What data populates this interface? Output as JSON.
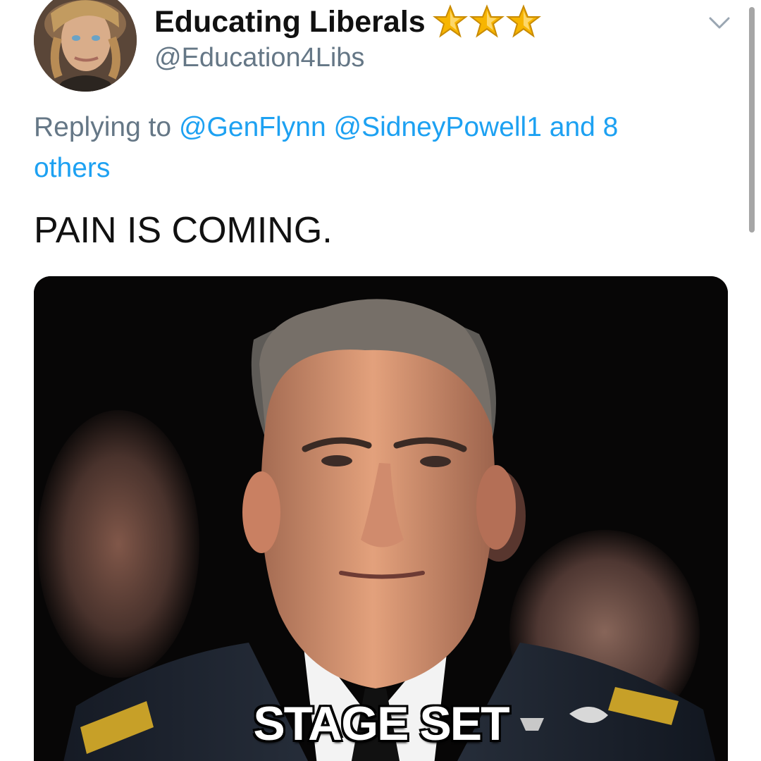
{
  "tweet": {
    "display_name": "Educating Liberals",
    "handle": "@Education4Libs",
    "reply": {
      "prefix": "Replying to",
      "mentions": [
        "@GenFlynn",
        "@SidneyPowell1"
      ],
      "connector": "and 8",
      "others_label": "others"
    },
    "text": "PAIN IS COMING.",
    "media": {
      "caption": "STAGE SET"
    }
  },
  "icons": {
    "menu": "chevron-down-icon",
    "badge": "star-icon"
  },
  "colors": {
    "link": "#1da1f2",
    "secondary_text": "#657786",
    "primary_text": "#111111",
    "star_gold": "#f7b500"
  }
}
